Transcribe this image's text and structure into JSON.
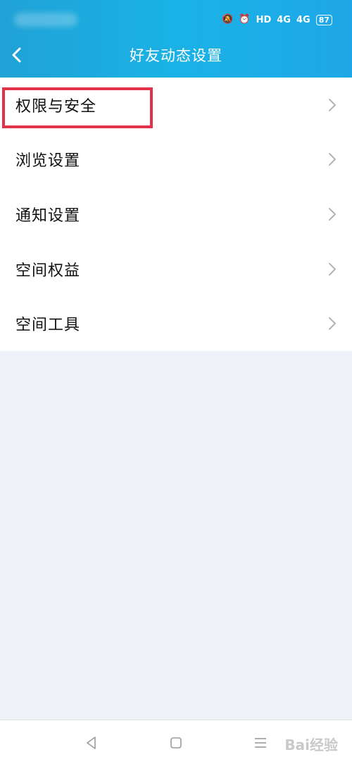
{
  "status_bar": {
    "network": "HD",
    "signal_1": "4G",
    "signal_2": "4G",
    "battery": "87"
  },
  "header": {
    "title": "好友动态设置",
    "back_icon": "chevron-left-icon"
  },
  "menu": {
    "items": [
      {
        "label": "权限与安全"
      },
      {
        "label": "浏览设置"
      },
      {
        "label": "通知设置"
      },
      {
        "label": "空间权益"
      },
      {
        "label": "空间工具"
      }
    ]
  },
  "colors": {
    "header_gradient_start": "#1fa2d6",
    "header_gradient_end": "#1ea7e8",
    "background": "#eef1f8",
    "highlight": "#e0334a",
    "chevron": "#b3b3b3"
  },
  "bottom_nav": {
    "buttons": [
      "back-triangle-icon",
      "home-square-icon",
      "menu-lines-icon"
    ]
  },
  "watermark": "Bai经验"
}
